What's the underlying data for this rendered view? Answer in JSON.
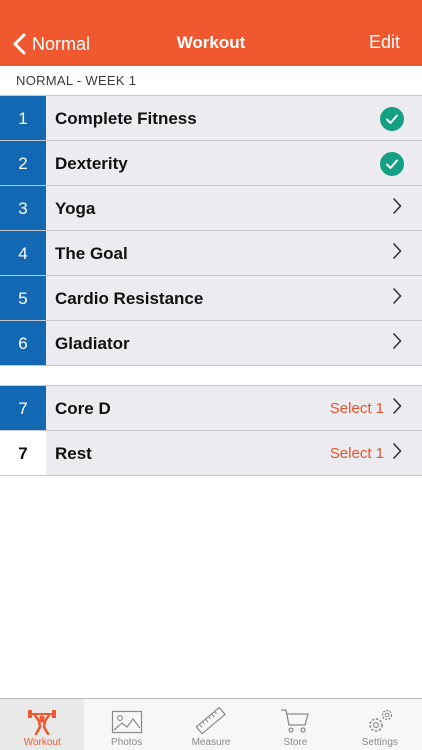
{
  "nav": {
    "back_label": "Normal",
    "title": "Workout",
    "edit_label": "Edit"
  },
  "section": {
    "header": "NORMAL - WEEK 1"
  },
  "workouts": [
    {
      "day": "1",
      "name": "Complete Fitness",
      "status": "completed"
    },
    {
      "day": "2",
      "name": "Dexterity",
      "status": "completed"
    },
    {
      "day": "3",
      "name": "Yoga",
      "status": "open"
    },
    {
      "day": "4",
      "name": "The Goal",
      "status": "open"
    },
    {
      "day": "5",
      "name": "Cardio Resistance",
      "status": "open"
    },
    {
      "day": "6",
      "name": "Gladiator",
      "status": "open"
    }
  ],
  "choices": [
    {
      "day": "7",
      "name": "Core D",
      "select_label": "Select 1"
    },
    {
      "day": "7",
      "name": "Rest",
      "select_label": "Select 1"
    }
  ],
  "tabs": [
    {
      "label": "Workout",
      "icon": "weightlifter-icon",
      "active": true
    },
    {
      "label": "Photos",
      "icon": "photo-icon",
      "active": false
    },
    {
      "label": "Measure",
      "icon": "ruler-icon",
      "active": false
    },
    {
      "label": "Store",
      "icon": "cart-icon",
      "active": false
    },
    {
      "label": "Settings",
      "icon": "gears-icon",
      "active": false
    }
  ],
  "colors": {
    "nav_bar": "#f0592f",
    "day_badge": "#1368b3",
    "check": "#14a085",
    "select_text": "#e6522c",
    "row_bg": "#ececf0"
  }
}
